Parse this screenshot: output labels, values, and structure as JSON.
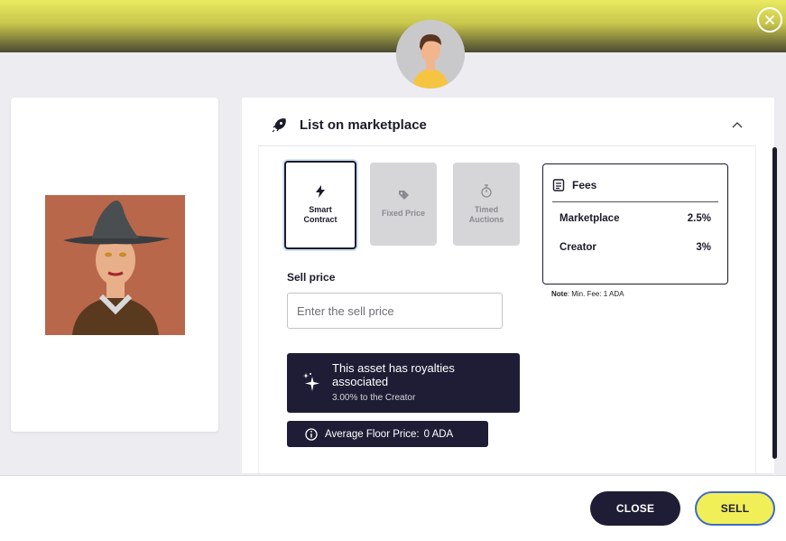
{
  "header": {
    "close_icon": "close-circle-icon"
  },
  "listing": {
    "title": "List on marketplace",
    "options": [
      {
        "label": "Smart Contract",
        "icon": "lightning-icon",
        "state": "selected"
      },
      {
        "label": "Fixed Price",
        "icon": "tag-icon",
        "state": "disabled"
      },
      {
        "label": "Timed Auctions",
        "icon": "stopwatch-icon",
        "state": "disabled"
      }
    ],
    "sell_price_label": "Sell price",
    "sell_price_placeholder": "Enter the sell price",
    "sell_price_value": ""
  },
  "fees": {
    "title": "Fees",
    "rows": [
      {
        "label": "Marketplace",
        "value": "2.5%"
      },
      {
        "label": "Creator",
        "value": "3%"
      }
    ],
    "note_label": "Note",
    "note_text": ": Min. Fee: 1 ADA"
  },
  "royalties": {
    "title": "This asset has royalties associated",
    "subtitle": "3.00% to the Creator"
  },
  "floor_price": {
    "label": "Average Floor Price:",
    "value": "0 ADA"
  },
  "footer": {
    "close_label": "CLOSE",
    "sell_label": "SELL"
  },
  "colors": {
    "dark": "#1f1d35",
    "accent_yellow": "#f1ef57",
    "focus_blue": "#3d6bc9"
  }
}
